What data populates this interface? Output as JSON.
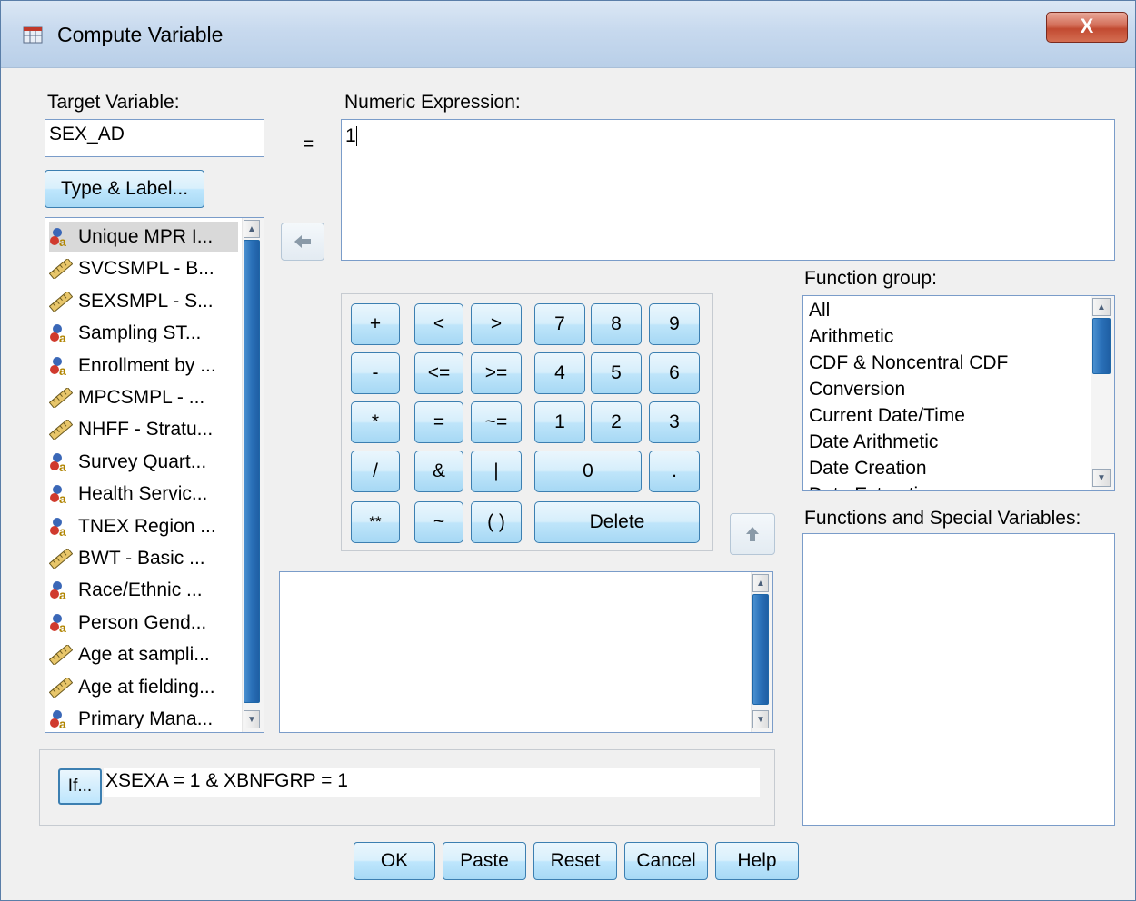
{
  "window": {
    "title": "Compute Variable",
    "close_label": "X"
  },
  "target_variable": {
    "label": "Target Variable:",
    "value": "SEX_AD"
  },
  "equals_sign": "=",
  "numeric_expression": {
    "label": "Numeric Expression:",
    "value": "1"
  },
  "type_label_button": "Type & Label...",
  "variables": [
    {
      "label": "Unique MPR I...",
      "icon": "nominal-icon"
    },
    {
      "label": "SVCSMPL - B...",
      "icon": "scale-ruler-icon"
    },
    {
      "label": "SEXSMPL - S...",
      "icon": "scale-ruler-icon"
    },
    {
      "label": "Sampling ST...",
      "icon": "nominal-icon"
    },
    {
      "label": "Enrollment by ...",
      "icon": "nominal-icon"
    },
    {
      "label": "MPCSMPL - ...",
      "icon": "scale-ruler-icon"
    },
    {
      "label": "NHFF - Stratu...",
      "icon": "scale-ruler-icon"
    },
    {
      "label": "Survey Quart...",
      "icon": "nominal-icon"
    },
    {
      "label": "Health Servic...",
      "icon": "nominal-icon"
    },
    {
      "label": "TNEX Region ...",
      "icon": "nominal-icon"
    },
    {
      "label": "BWT - Basic ...",
      "icon": "scale-ruler-icon"
    },
    {
      "label": "Race/Ethnic ...",
      "icon": "nominal-icon"
    },
    {
      "label": "Person Gend...",
      "icon": "nominal-icon"
    },
    {
      "label": "Age at sampli...",
      "icon": "scale-ruler-icon"
    },
    {
      "label": "Age at fielding...",
      "icon": "scale-ruler-icon"
    },
    {
      "label": "Primary Mana...",
      "icon": "nominal-icon"
    }
  ],
  "keypad": {
    "plus": "+",
    "lt": "<",
    "gt": ">",
    "k7": "7",
    "k8": "8",
    "k9": "9",
    "minus": "-",
    "le": "<=",
    "ge": ">=",
    "k4": "4",
    "k5": "5",
    "k6": "6",
    "mult": "*",
    "eq": "=",
    "ne": "~=",
    "k1": "1",
    "k2": "2",
    "k3": "3",
    "div": "/",
    "and": "&",
    "or": "|",
    "k0": "0",
    "dot": ".",
    "pow": "**",
    "not": "~",
    "parens": "( )",
    "delete": "Delete"
  },
  "function_group": {
    "label": "Function group:",
    "items": [
      "All",
      "Arithmetic",
      "CDF & Noncentral CDF",
      "Conversion",
      "Current Date/Time",
      "Date Arithmetic",
      "Date Creation",
      "Date Extraction"
    ]
  },
  "functions_special": {
    "label": "Functions and Special Variables:"
  },
  "if_condition": {
    "button": "If...",
    "value": "XSEXA = 1 & XBNFGRP = 1"
  },
  "footer": {
    "ok": "OK",
    "paste": "Paste",
    "reset": "Reset",
    "cancel": "Cancel",
    "help": "Help"
  },
  "colors": {
    "accent": "#3c7fb1",
    "scroll_thumb": "#2a70b8",
    "close_button": "#c24a31"
  }
}
